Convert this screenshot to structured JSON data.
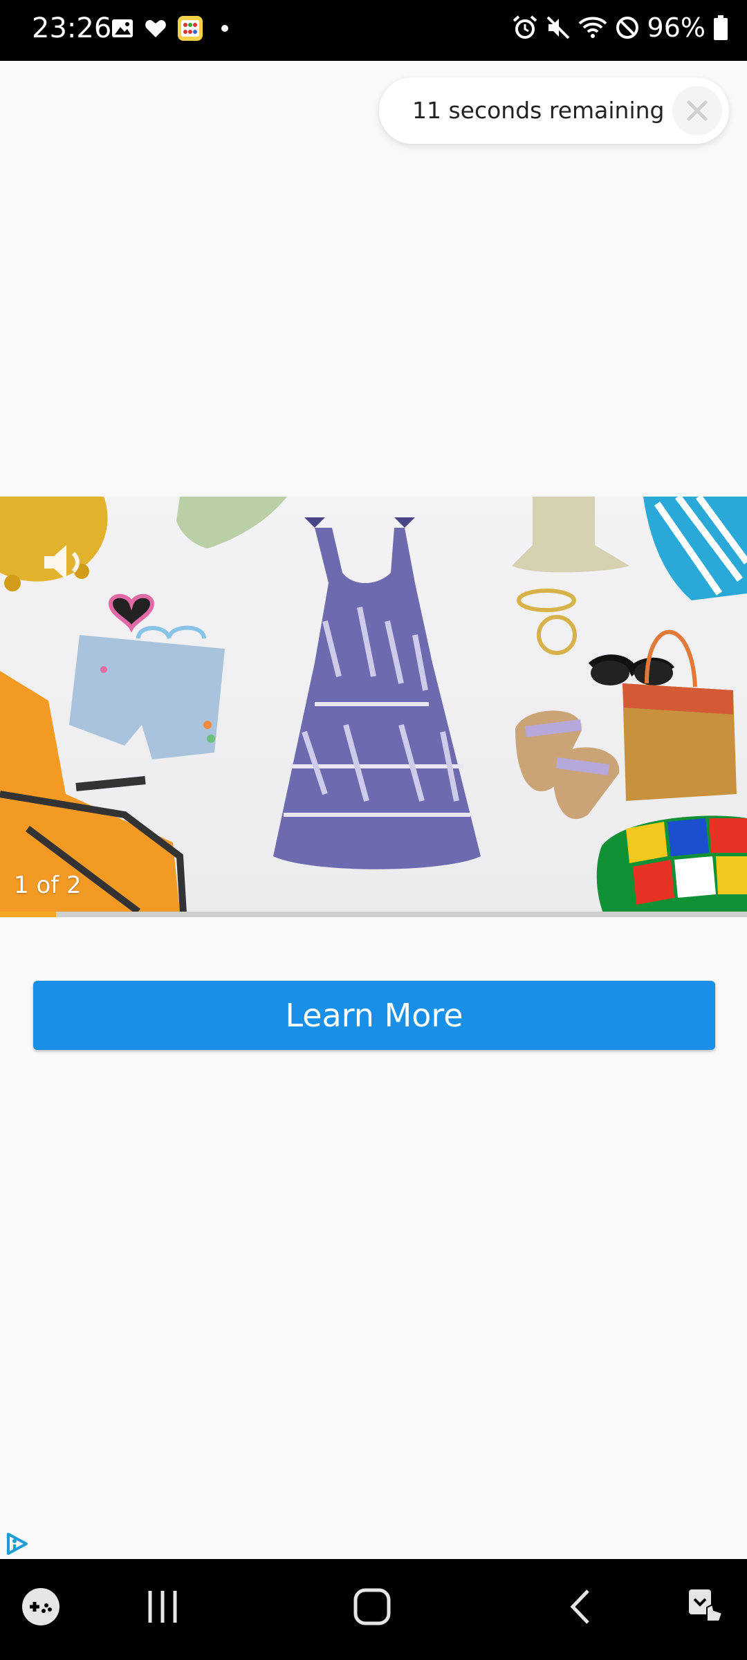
{
  "status_bar": {
    "time": "23:26",
    "battery_percent": "96%",
    "left_icons": [
      "gallery-icon",
      "heart-icon",
      "app-icon",
      "dot-icon"
    ],
    "right_icons": [
      "alarm-icon",
      "mute-icon",
      "wifi-icon",
      "do-not-disturb-icon",
      "battery-icon"
    ]
  },
  "ad": {
    "countdown_text": "11 seconds remaining",
    "slide_counter": "1 of 2",
    "progress": 0.075,
    "cta_label": "Learn More",
    "accent_color": "#1a8fe8",
    "progress_color": "#f5a623"
  },
  "nav_bar": {
    "items": [
      "game-launcher-icon",
      "recent-apps-icon",
      "home-icon",
      "back-icon",
      "accessibility-icon"
    ]
  }
}
